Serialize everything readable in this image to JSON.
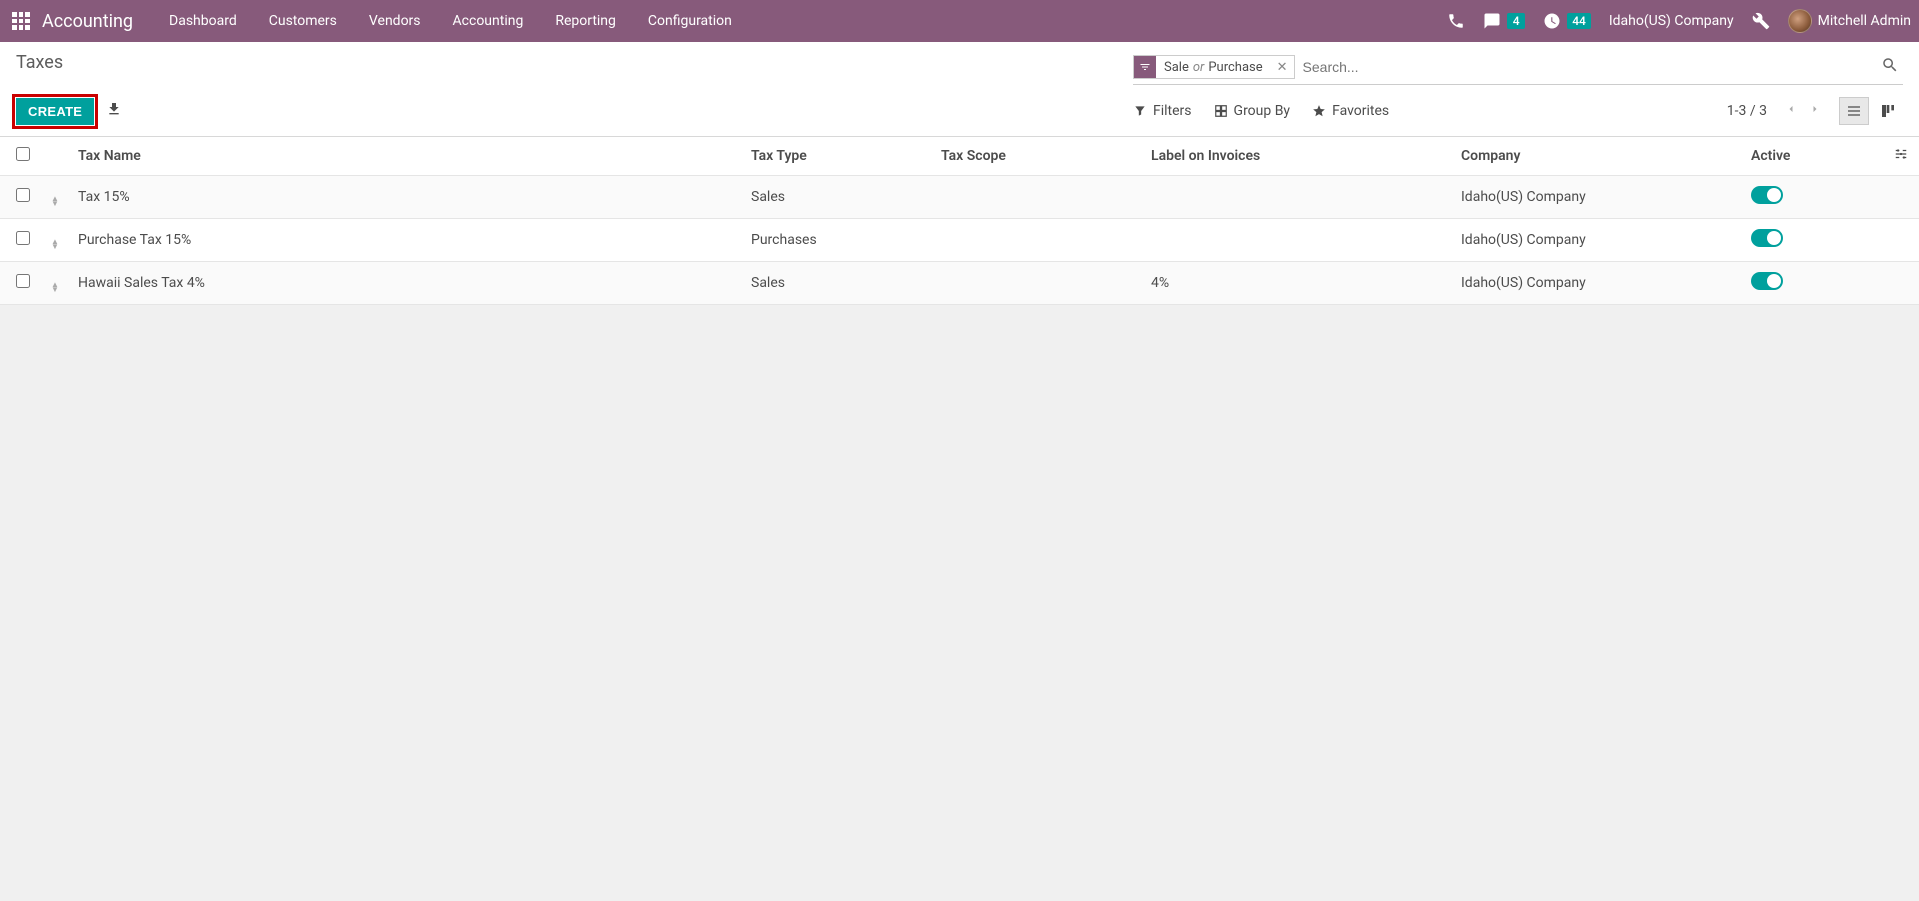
{
  "navbar": {
    "brand": "Accounting",
    "items": [
      "Dashboard",
      "Customers",
      "Vendors",
      "Accounting",
      "Reporting",
      "Configuration"
    ],
    "messages_badge": "4",
    "activities_badge": "44",
    "company": "Idaho(US) Company",
    "user": "Mitchell Admin"
  },
  "control": {
    "breadcrumb": "Taxes",
    "create_label": "CREATE",
    "search_placeholder": "Search...",
    "facet_part1": "Sale",
    "facet_or": "or",
    "facet_part2": "Purchase",
    "filters_label": "Filters",
    "groupby_label": "Group By",
    "favorites_label": "Favorites",
    "pager": "1-3 / 3"
  },
  "table": {
    "headers": {
      "name": "Tax Name",
      "type": "Tax Type",
      "scope": "Tax Scope",
      "label": "Label on Invoices",
      "company": "Company",
      "active": "Active"
    },
    "rows": [
      {
        "name": "Tax 15%",
        "type": "Sales",
        "scope": "",
        "label": "",
        "company": "Idaho(US) Company",
        "active": true
      },
      {
        "name": "Purchase Tax 15%",
        "type": "Purchases",
        "scope": "",
        "label": "",
        "company": "Idaho(US) Company",
        "active": true
      },
      {
        "name": "Hawaii Sales Tax 4%",
        "type": "Sales",
        "scope": "",
        "label": "4%",
        "company": "Idaho(US) Company",
        "active": true
      }
    ]
  }
}
